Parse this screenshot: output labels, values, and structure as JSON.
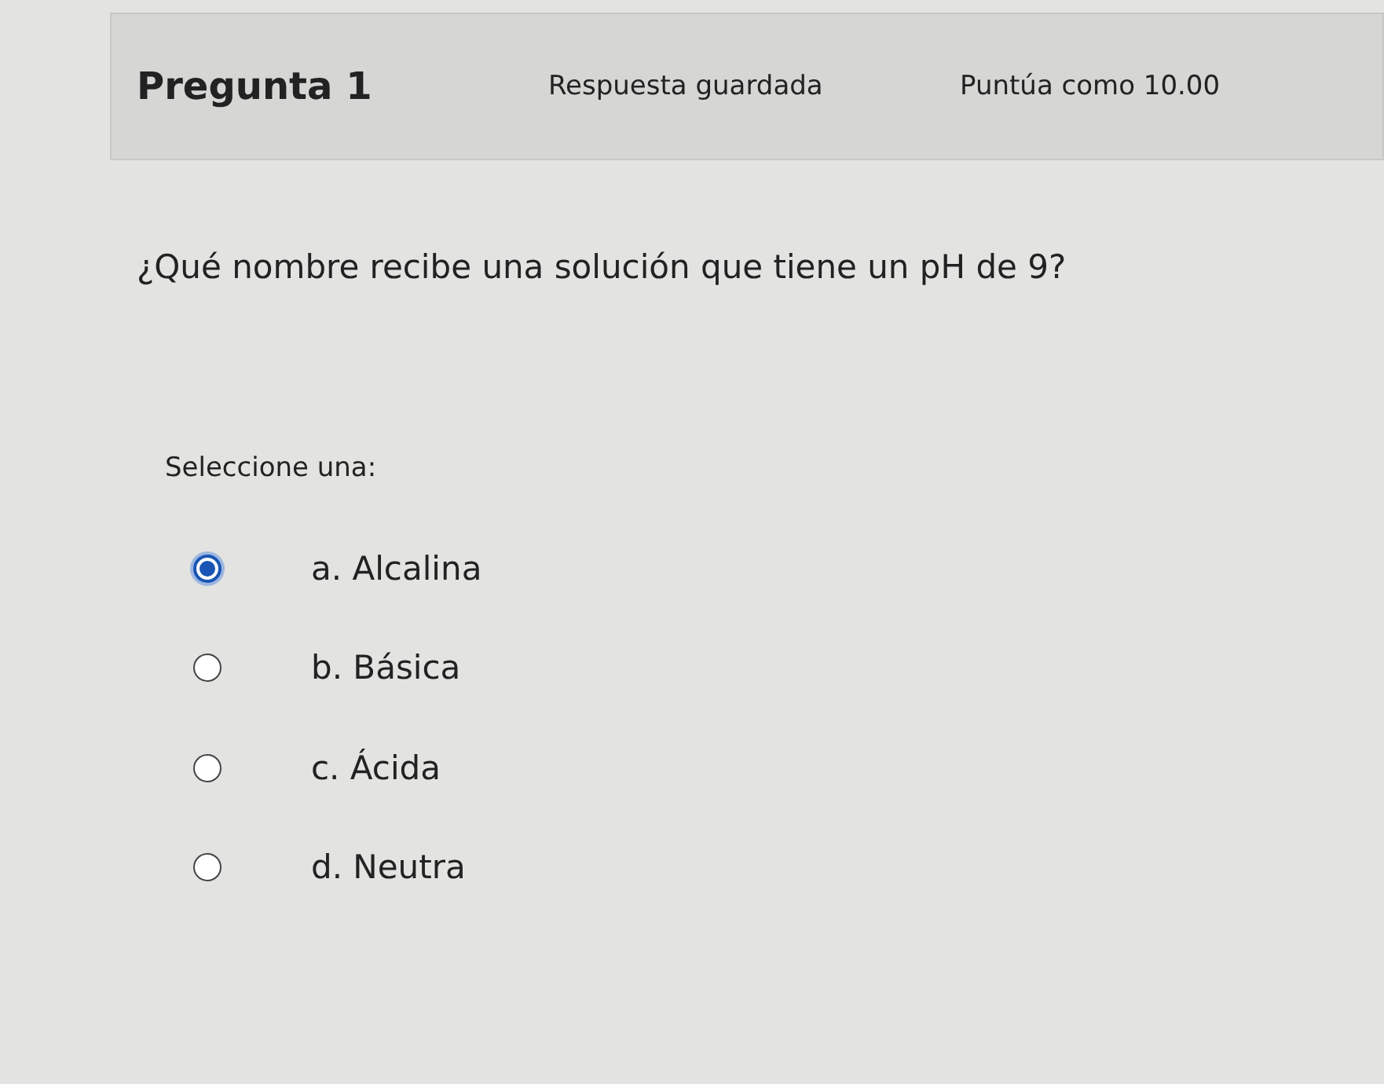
{
  "header": {
    "title": "Pregunta 1",
    "status": "Respuesta guardada",
    "grade": "Puntúa como 10.00"
  },
  "question": "¿Qué nombre recibe una solución que tiene un pH de 9?",
  "prompt": "Seleccione una:",
  "options": [
    {
      "label": "a. Alcalina",
      "selected": true
    },
    {
      "label": "b. Básica",
      "selected": false
    },
    {
      "label": "c. Ácida",
      "selected": false
    },
    {
      "label": "d. Neutra",
      "selected": false
    }
  ]
}
